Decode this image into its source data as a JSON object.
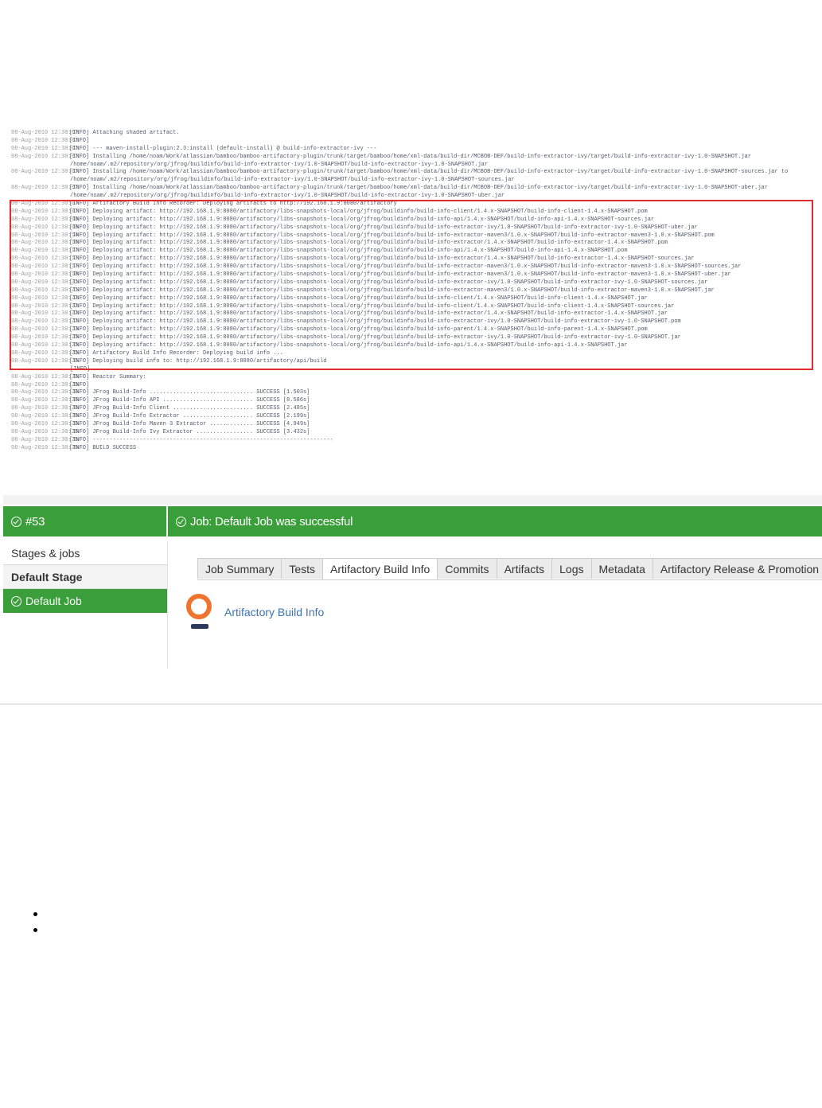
{
  "log_lines": [
    {
      "ts": "08-Aug-2010 12:30:07",
      "msg": "[INFO] Attaching shaded artifact."
    },
    {
      "ts": "08-Aug-2010 12:30:07",
      "msg": "[INFO]"
    },
    {
      "ts": "08-Aug-2010 12:30:07",
      "msg": "[INFO] --- maven-install-plugin:2.3:install (default-install) @ build-info-extractor-ivy ---"
    },
    {
      "ts": "08-Aug-2010 12:30:07",
      "msg": "[INFO] Installing /home/noam/Work/atlassian/bamboo/bamboo-artifactory-plugin/trunk/target/bamboo/home/xml-data/build-dir/MCBOB-DEF/build-info-extractor-ivy/target/build-info-extractor-ivy-1.0-SNAPSHOT.jar"
    },
    {
      "ts": "",
      "msg": "/home/noam/.m2/repository/org/jfrog/buildinfo/build-info-extractor-ivy/1.0-SNAPSHOT/build-info-extractor-ivy-1.0-SNAPSHOT.jar"
    },
    {
      "ts": "08-Aug-2010 12:30:07",
      "msg": "[INFO] Installing /home/noam/Work/atlassian/bamboo/bamboo-artifactory-plugin/trunk/target/bamboo/home/xml-data/build-dir/MCBOB-DEF/build-info-extractor-ivy/target/build-info-extractor-ivy-1.0-SNAPSHOT-sources.jar to"
    },
    {
      "ts": "",
      "msg": "/home/noam/.m2/repository/org/jfrog/buildinfo/build-info-extractor-ivy/1.0-SNAPSHOT/build-info-extractor-ivy-1.0-SNAPSHOT-sources.jar"
    },
    {
      "ts": "08-Aug-2010 12:30:07",
      "msg": "[INFO] Installing /home/noam/Work/atlassian/bamboo/bamboo-artifactory-plugin/trunk/target/bamboo/home/xml-data/build-dir/MCBOB-DEF/build-info-extractor-ivy/target/build-info-extractor-ivy-1.0-SNAPSHOT-uber.jar"
    },
    {
      "ts": "",
      "msg": "/home/noam/.m2/repository/org/jfrog/buildinfo/build-info-extractor-ivy/1.0-SNAPSHOT/build-info-extractor-ivy-1.0-SNAPSHOT-uber.jar"
    },
    {
      "ts": "08-Aug-2010 12:30:07",
      "msg": "[INFO] Artifactory Build Info Recorder: Deploying artifacts to http://192.168.1.9:8080/artifactory"
    },
    {
      "ts": "08-Aug-2010 12:30:07",
      "msg": "[INFO] Deploying artifact: http://192.168.1.9:8080/artifactory/libs-snapshots-local/org/jfrog/buildinfo/build-info-client/1.4.x-SNAPSHOT/build-info-client-1.4.x-SNAPSHOT.pom"
    },
    {
      "ts": "08-Aug-2010 12:30:08",
      "msg": "[INFO] Deploying artifact: http://192.168.1.9:8080/artifactory/libs-snapshots-local/org/jfrog/buildinfo/build-info-api/1.4.x-SNAPSHOT/build-info-api-1.4.x-SNAPSHOT-sources.jar"
    },
    {
      "ts": "08-Aug-2010 12:30:08",
      "msg": "[INFO] Deploying artifact: http://192.168.1.9:8080/artifactory/libs-snapshots-local/org/jfrog/buildinfo/build-info-extractor-ivy/1.0-SNAPSHOT/build-info-extractor-ivy-1.0-SNAPSHOT-uber.jar"
    },
    {
      "ts": "08-Aug-2010 12:30:14",
      "msg": "[INFO] Deploying artifact: http://192.168.1.9:8080/artifactory/libs-snapshots-local/org/jfrog/buildinfo/build-info-extractor-maven3/1.0.x-SNAPSHOT/build-info-extractor-maven3-1.0.x-SNAPSHOT.pom"
    },
    {
      "ts": "08-Aug-2010 12:30:16",
      "msg": "[INFO] Deploying artifact: http://192.168.1.9:8080/artifactory/libs-snapshots-local/org/jfrog/buildinfo/build-info-extractor/1.4.x-SNAPSHOT/build-info-extractor-1.4.x-SNAPSHOT.pom"
    },
    {
      "ts": "08-Aug-2010 12:30:17",
      "msg": "[INFO] Deploying artifact: http://192.168.1.9:8080/artifactory/libs-snapshots-local/org/jfrog/buildinfo/build-info-api/1.4.x-SNAPSHOT/build-info-api-1.4.x-SNAPSHOT.pom"
    },
    {
      "ts": "08-Aug-2010 12:30:17",
      "msg": "[INFO] Deploying artifact: http://192.168.1.9:8080/artifactory/libs-snapshots-local/org/jfrog/buildinfo/build-info-extractor/1.4.x-SNAPSHOT/build-info-extractor-1.4.x-SNAPSHOT-sources.jar"
    },
    {
      "ts": "08-Aug-2010 12:30:17",
      "msg": "[INFO] Deploying artifact: http://192.168.1.9:8080/artifactory/libs-snapshots-local/org/jfrog/buildinfo/build-info-extractor-maven3/1.0.x-SNAPSHOT/build-info-extractor-maven3-1.0.x-SNAPSHOT-sources.jar"
    },
    {
      "ts": "08-Aug-2010 12:30:18",
      "msg": "[INFO] Deploying artifact: http://192.168.1.9:8080/artifactory/libs-snapshots-local/org/jfrog/buildinfo/build-info-extractor-maven3/1.0.x-SNAPSHOT/build-info-extractor-maven3-1.0.x-SNAPSHOT-uber.jar"
    },
    {
      "ts": "08-Aug-2010 12:30:21",
      "msg": "[INFO] Deploying artifact: http://192.168.1.9:8080/artifactory/libs-snapshots-local/org/jfrog/buildinfo/build-info-extractor-ivy/1.0-SNAPSHOT/build-info-extractor-ivy-1.0-SNAPSHOT-sources.jar"
    },
    {
      "ts": "08-Aug-2010 12:30:21",
      "msg": "[INFO] Deploying artifact: http://192.168.1.9:8080/artifactory/libs-snapshots-local/org/jfrog/buildinfo/build-info-extractor-maven3/1.0.x-SNAPSHOT/build-info-extractor-maven3-1.0.x-SNAPSHOT.jar"
    },
    {
      "ts": "08-Aug-2010 12:30:22",
      "msg": "[INFO] Deploying artifact: http://192.168.1.9:8080/artifactory/libs-snapshots-local/org/jfrog/buildinfo/build-info-client/1.4.x-SNAPSHOT/build-info-client-1.4.x-SNAPSHOT.jar"
    },
    {
      "ts": "08-Aug-2010 12:30:22",
      "msg": "[INFO] Deploying artifact: http://192.168.1.9:8080/artifactory/libs-snapshots-local/org/jfrog/buildinfo/build-info-client/1.4.x-SNAPSHOT/build-info-client-1.4.x-SNAPSHOT-sources.jar"
    },
    {
      "ts": "08-Aug-2010 12:30:22",
      "msg": "[INFO] Deploying artifact: http://192.168.1.9:8080/artifactory/libs-snapshots-local/org/jfrog/buildinfo/build-info-extractor/1.4.x-SNAPSHOT/build-info-extractor-1.4.x-SNAPSHOT.jar"
    },
    {
      "ts": "08-Aug-2010 12:30:22",
      "msg": "[INFO] Deploying artifact: http://192.168.1.9:8080/artifactory/libs-snapshots-local/org/jfrog/buildinfo/build-info-extractor-ivy/1.0-SNAPSHOT/build-info-extractor-ivy-1.0-SNAPSHOT.pom"
    },
    {
      "ts": "08-Aug-2010 12:30:23",
      "msg": "[INFO] Deploying artifact: http://192.168.1.9:8080/artifactory/libs-snapshots-local/org/jfrog/buildinfo/build-info-parent/1.4.x-SNAPSHOT/build-info-parent-1.4.x-SNAPSHOT.pom"
    },
    {
      "ts": "08-Aug-2010 12:30:25",
      "msg": "[INFO] Deploying artifact: http://192.168.1.9:8080/artifactory/libs-snapshots-local/org/jfrog/buildinfo/build-info-extractor-ivy/1.0-SNAPSHOT/build-info-extractor-ivy-1.0-SNAPSHOT.jar"
    },
    {
      "ts": "08-Aug-2010 12:30:25",
      "msg": "[INFO] Deploying artifact: http://192.168.1.9:8080/artifactory/libs-snapshots-local/org/jfrog/buildinfo/build-info-api/1.4.x-SNAPSHOT/build-info-api-1.4.x-SNAPSHOT.jar"
    },
    {
      "ts": "08-Aug-2010 12:30:25",
      "msg": "[INFO] Artifactory Build Info Recorder: Deploying build info ..."
    },
    {
      "ts": "08-Aug-2010 12:30:26",
      "msg": "[INFO] Deploying build info to: http://192.168.1.9:8080/artifactory/api/build"
    },
    {
      "ts": "",
      "msg": "[INFO]"
    },
    {
      "ts": "08-Aug-2010 12:30:26",
      "msg": "[INFO] Reactor Summary:"
    },
    {
      "ts": "08-Aug-2010 12:30:26",
      "msg": "[INFO]"
    },
    {
      "ts": "08-Aug-2010 12:30:26",
      "msg": "[INFO] JFrog Build-Info ............................... SUCCESS [1.503s]"
    },
    {
      "ts": "08-Aug-2010 12:30:26",
      "msg": "[INFO] JFrog Build-Info API ........................... SUCCESS [8.586s]"
    },
    {
      "ts": "08-Aug-2010 12:30:26",
      "msg": "[INFO] JFrog Build-Info Client ........................ SUCCESS [2.485s]"
    },
    {
      "ts": "08-Aug-2010 12:30:26",
      "msg": "[INFO] JFrog Build-Info Extractor ..................... SUCCESS [2.199s]"
    },
    {
      "ts": "08-Aug-2010 12:30:26",
      "msg": "[INFO] JFrog Build-Info Maven 3 Extractor ............. SUCCESS [4.949s]"
    },
    {
      "ts": "08-Aug-2010 12:30:26",
      "msg": "[INFO] JFrog Build-Info Ivy Extractor ................. SUCCESS [3.432s]"
    },
    {
      "ts": "08-Aug-2010 12:30:26",
      "msg": "[INFO] ------------------------------------------------------------------------"
    },
    {
      "ts": "08-Aug-2010 12:30:26",
      "msg": "[INFO] BUILD SUCCESS"
    }
  ],
  "build": {
    "number": "#53",
    "job_status": "Job: Default Job was successful"
  },
  "sidebar": {
    "stages_label": "Stages & jobs",
    "stage_label": "Default Stage",
    "job_label": "Default Job"
  },
  "tabs": [
    {
      "label": "Job Summary"
    },
    {
      "label": "Tests"
    },
    {
      "label": "Artifactory Build Info"
    },
    {
      "label": "Commits"
    },
    {
      "label": "Artifacts"
    },
    {
      "label": "Logs"
    },
    {
      "label": "Metadata"
    },
    {
      "label": "Artifactory Release & Promotion"
    }
  ],
  "active_tab": "Artifactory Build Info",
  "plugin": {
    "link_label": "Artifactory Build Info",
    "icon": "artifactory-logo-icon"
  },
  "colors": {
    "success_green": "#3a9e3a",
    "highlight_red": "#e02c2c",
    "link_blue": "#3b73af",
    "artifactory_orange": "#f0742e"
  }
}
